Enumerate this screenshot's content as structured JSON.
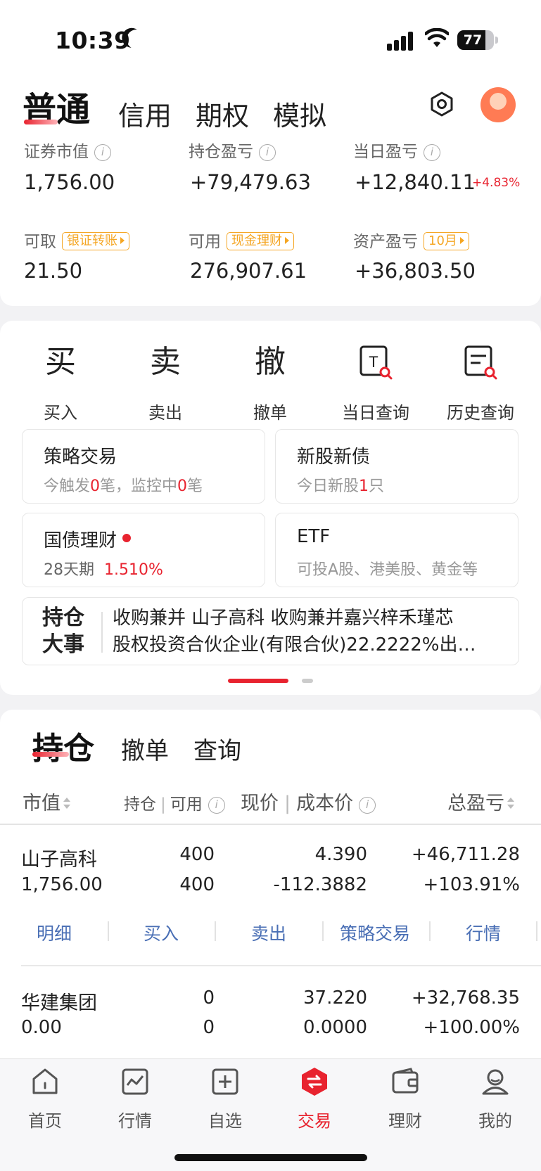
{
  "status_bar": {
    "time": "10:39",
    "battery": "77",
    "battery_level": 0.77
  },
  "account_tabs": [
    {
      "label": "普通",
      "active": true
    },
    {
      "label": "信用",
      "active": false
    },
    {
      "label": "期权",
      "active": false
    },
    {
      "label": "模拟",
      "active": false
    }
  ],
  "summary": {
    "market_value_label": "证券市值",
    "market_value": "1,756.00",
    "position_pl_label": "持仓盈亏",
    "position_pl": "+79,479.63",
    "daily_pl_label": "当日盈亏",
    "daily_pl": "+12,840.11",
    "daily_pl_pct": "+4.83%",
    "withdrawable_label": "可取",
    "withdrawable_pill": "银证转账",
    "withdrawable": "21.50",
    "available_label": "可用",
    "available_pill": "现金理财",
    "available": "276,907.61",
    "asset_pl_label": "资产盈亏",
    "asset_pl_pill": "10月",
    "asset_pl": "+36,803.50"
  },
  "quick_actions": [
    {
      "glyph": "买",
      "label": "买入"
    },
    {
      "glyph": "卖",
      "label": "卖出"
    },
    {
      "glyph": "撤",
      "label": "撤单"
    },
    {
      "glyph": "T",
      "label": "当日查询"
    },
    {
      "glyph": "",
      "label": "历史查询"
    }
  ],
  "feature_boxes": {
    "strategy": {
      "title": "策略交易",
      "sub_a": "今触发",
      "count_a": "0",
      "sub_b": "笔，监控中",
      "count_b": "0",
      "sub_c": "笔"
    },
    "ipo": {
      "title": "新股新债",
      "sub_a": "今日新股",
      "count_a": "1",
      "sub_b": "只"
    },
    "bond": {
      "title": "国债理财",
      "term": "28天期",
      "rate": "1.510%"
    },
    "etf": {
      "title": "ETF",
      "sub": "可投A股、港美股、黄金等"
    }
  },
  "event": {
    "tag_line1": "持仓",
    "tag_line2": "大事",
    "text_line1": "收购兼并 山子高科 收购兼并嘉兴梓禾瑾芯",
    "text_line2": "股权投资合伙企业(有限合伙)22.2222%出…"
  },
  "holding_tabs": [
    {
      "label": "持仓",
      "active": true
    },
    {
      "label": "撤单",
      "active": false
    },
    {
      "label": "查询",
      "active": false
    }
  ],
  "columns": {
    "market_value": "市值",
    "position": "持仓",
    "available": "可用",
    "price": "现价",
    "cost": "成本价",
    "total_pl": "总盈亏",
    "sep": "|"
  },
  "holdings": [
    {
      "name": "山子高科",
      "market_value": "1,756.00",
      "position": "400",
      "available": "400",
      "price": "4.390",
      "cost": "-112.3882",
      "pl": "+46,711.28",
      "pl_pct": "+103.91%"
    },
    {
      "name": "华建集团",
      "market_value": "0.00",
      "position": "0",
      "available": "0",
      "price": "37.220",
      "cost": "0.0000",
      "pl": "+32,768.35",
      "pl_pct": "+100.00%"
    }
  ],
  "row_actions": [
    "明细",
    "买入",
    "卖出",
    "策略交易",
    "行情"
  ],
  "tabbar": [
    {
      "label": "首页",
      "icon": "home-icon"
    },
    {
      "label": "行情",
      "icon": "chart-icon"
    },
    {
      "label": "自选",
      "icon": "add-icon"
    },
    {
      "label": "交易",
      "icon": "trade-icon",
      "active": true
    },
    {
      "label": "理财",
      "icon": "wallet-icon"
    },
    {
      "label": "我的",
      "icon": "user-icon"
    }
  ],
  "colors": {
    "accent": "#e8232f",
    "link": "#4a6fb5",
    "pill": "#f5a623"
  }
}
